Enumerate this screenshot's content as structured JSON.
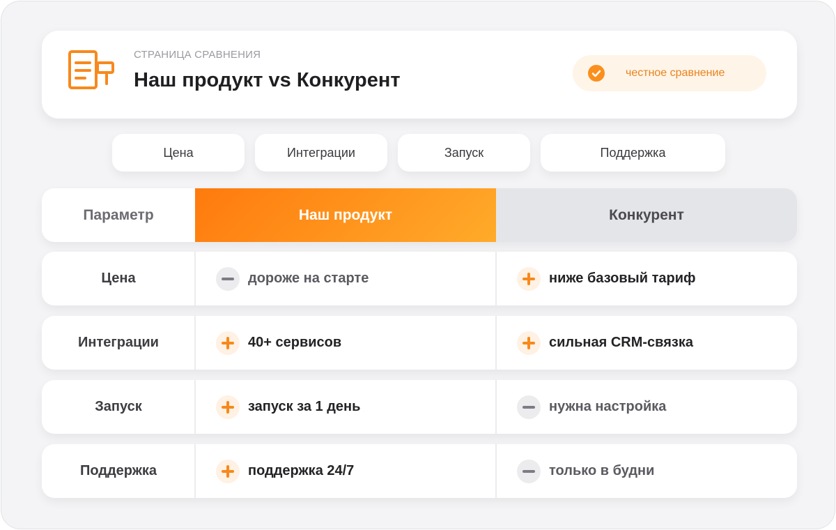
{
  "header": {
    "subtitle": "СТРАНИЦА СРАВНЕНИЯ",
    "title": "Наш продукт vs Конкурент",
    "icon": "document-icon",
    "badge": {
      "label": "честное сравнение",
      "icon": "check-circle-icon"
    }
  },
  "tabs": [
    {
      "label": "Цена"
    },
    {
      "label": "Интеграции"
    },
    {
      "label": "Запуск"
    },
    {
      "label": "Поддержка"
    }
  ],
  "table": {
    "headers": {
      "param": "Параметр",
      "ours": "Наш продукт",
      "competitor": "Конкурент"
    },
    "rows": [
      {
        "param": "Цена",
        "ours": {
          "text": "дороже на старте",
          "mark": "minus"
        },
        "competitor": {
          "text": "ниже базовый тариф",
          "mark": "plus"
        }
      },
      {
        "param": "Интеграции",
        "ours": {
          "text": "40+ сервисов",
          "mark": "plus"
        },
        "competitor": {
          "text": "сильная CRM-связка",
          "mark": "plus"
        }
      },
      {
        "param": "Запуск",
        "ours": {
          "text": "запуск за 1 день",
          "mark": "plus"
        },
        "competitor": {
          "text": "нужна настройка",
          "mark": "minus"
        }
      },
      {
        "param": "Поддержка",
        "ours": {
          "text": "поддержка 24/7",
          "mark": "plus"
        },
        "competitor": {
          "text": "только в будни",
          "mark": "minus"
        }
      }
    ]
  },
  "colors": {
    "accent": "#ff8a1a",
    "accent_soft": "#fff4e8",
    "competitor_header": "#e4e5e8",
    "text_dark": "#1f1f22"
  }
}
